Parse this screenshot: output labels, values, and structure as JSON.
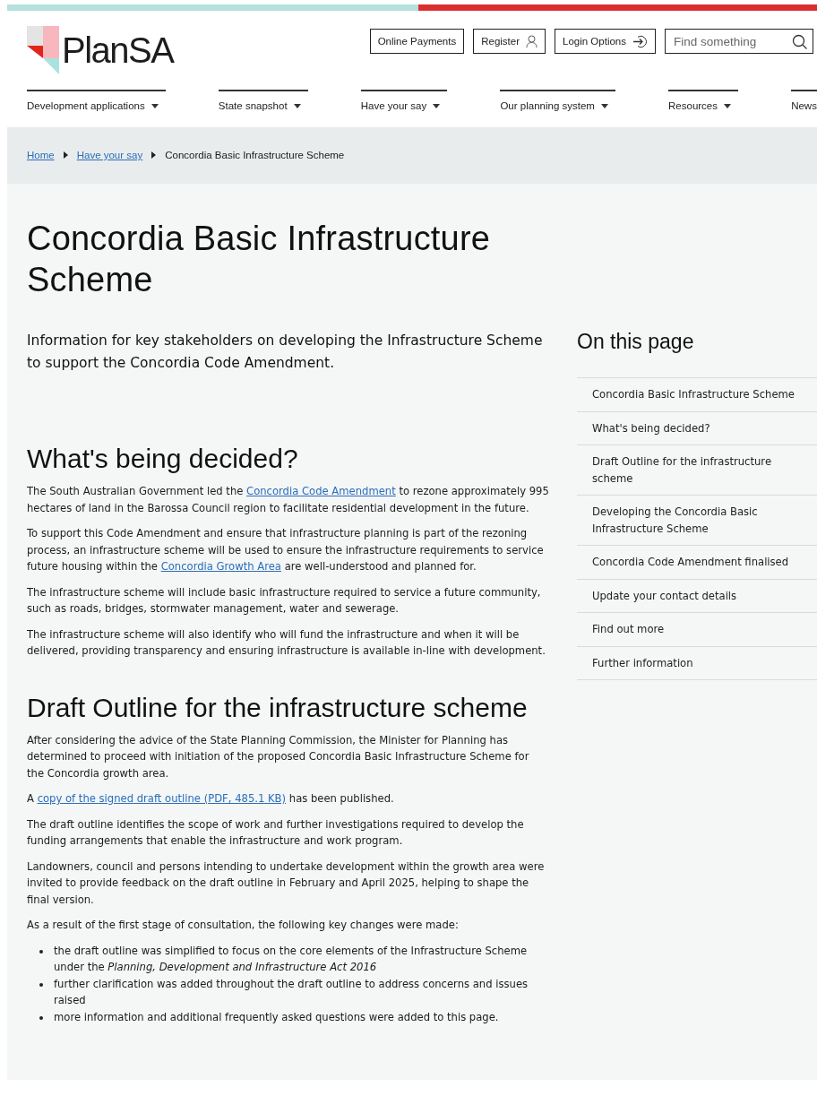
{
  "logo": {
    "text": "PlanSA"
  },
  "utility_buttons": [
    {
      "label": "Online Payments",
      "kind": "plain"
    },
    {
      "label": "Register",
      "kind": "user"
    },
    {
      "label": "Login Options",
      "kind": "login"
    }
  ],
  "search": {
    "placeholder": "Find something"
  },
  "nav": [
    {
      "label": "Development applications",
      "dropdown": true
    },
    {
      "label": "State snapshot",
      "dropdown": true
    },
    {
      "label": "Have your say",
      "dropdown": true
    },
    {
      "label": "Our planning system",
      "dropdown": true
    },
    {
      "label": "Resources",
      "dropdown": true
    },
    {
      "label": "News",
      "dropdown": false
    }
  ],
  "breadcrumb": {
    "links": [
      "Home",
      "Have your say"
    ],
    "current": "Concordia Basic Infrastructure Scheme"
  },
  "page_title": "Concordia Basic Infrastructure Scheme",
  "lead": "Information for key stakeholders on developing the Infrastructure Scheme to support the Concordia Code Amendment.",
  "sections": [
    {
      "heading": "What's being decided?",
      "blocks": [
        {
          "kind": "paragraph",
          "parts": [
            {
              "text": "The South Australian Government led the ",
              "kind": "text"
            },
            {
              "text": "Concordia Code Amendment",
              "kind": "link"
            },
            {
              "text": " to rezone approximately 995 hectares of land in the Barossa Council region to facilitate residential development in the future.",
              "kind": "text"
            }
          ]
        },
        {
          "kind": "paragraph",
          "parts": [
            {
              "text": "To support this Code Amendment and ensure that infrastructure planning is part of the rezoning process, an infrastructure scheme will be used to ensure the infrastructure requirements to service future housing within the ",
              "kind": "text"
            },
            {
              "text": "Concordia Growth Area",
              "kind": "link"
            },
            {
              "text": " are well-understood and planned for.",
              "kind": "text"
            }
          ]
        },
        {
          "kind": "paragraph",
          "parts": [
            {
              "text": "The infrastructure scheme will include basic infrastructure required to service a future community, such as roads, bridges, stormwater management, water and sewerage.",
              "kind": "text"
            }
          ]
        },
        {
          "kind": "paragraph",
          "parts": [
            {
              "text": "The infrastructure scheme will also identify who will fund the infrastructure and when it will be delivered, providing transparency and ensuring infrastructure is available in-line with development.",
              "kind": "text"
            }
          ]
        }
      ]
    },
    {
      "heading": "Draft Outline for the infrastructure scheme",
      "blocks": [
        {
          "kind": "paragraph",
          "parts": [
            {
              "text": "After considering the advice of the State Planning Commission, the Minister for Planning has determined to proceed with initiation of the proposed Concordia Basic Infrastructure Scheme for the Concordia growth area.",
              "kind": "text"
            }
          ]
        },
        {
          "kind": "paragraph",
          "parts": [
            {
              "text": "A ",
              "kind": "text"
            },
            {
              "text": "copy of the signed draft outline (PDF, 485.1 KB)",
              "kind": "link"
            },
            {
              "text": " has been published.",
              "kind": "text"
            }
          ]
        },
        {
          "kind": "paragraph",
          "parts": [
            {
              "text": "The draft outline identifies the scope of work and further investigations required to develop the funding arrangements that enable the infrastructure and work program.",
              "kind": "text"
            }
          ]
        },
        {
          "kind": "paragraph",
          "parts": [
            {
              "text": "Landowners, council and persons intending to undertake development within the growth area were invited to provide feedback on the draft outline in February and April 2025, helping to shape the final version.",
              "kind": "text"
            }
          ]
        },
        {
          "kind": "paragraph",
          "parts": [
            {
              "text": "As a result of the first stage of consultation, the following key changes were made:",
              "kind": "text"
            }
          ]
        },
        {
          "kind": "list",
          "items": [
            "the draft outline was simplified to focus on the core elements of the Infrastructure Scheme under the *Planning, Development and Infrastructure Act 2016*",
            "further clarification was added throughout the draft outline to address concerns and issues raised",
            "more information and additional frequently asked questions were added to this page."
          ]
        }
      ]
    }
  ],
  "toc": {
    "title": "On this page",
    "items": [
      "Concordia Basic Infrastructure Scheme",
      "What's being decided?",
      "Draft Outline for the infrastructure scheme",
      "Developing the Concordia Basic Infrastructure Scheme",
      "Concordia Code Amendment finalised",
      "Update your contact details",
      "Find out more",
      "Further information"
    ]
  }
}
